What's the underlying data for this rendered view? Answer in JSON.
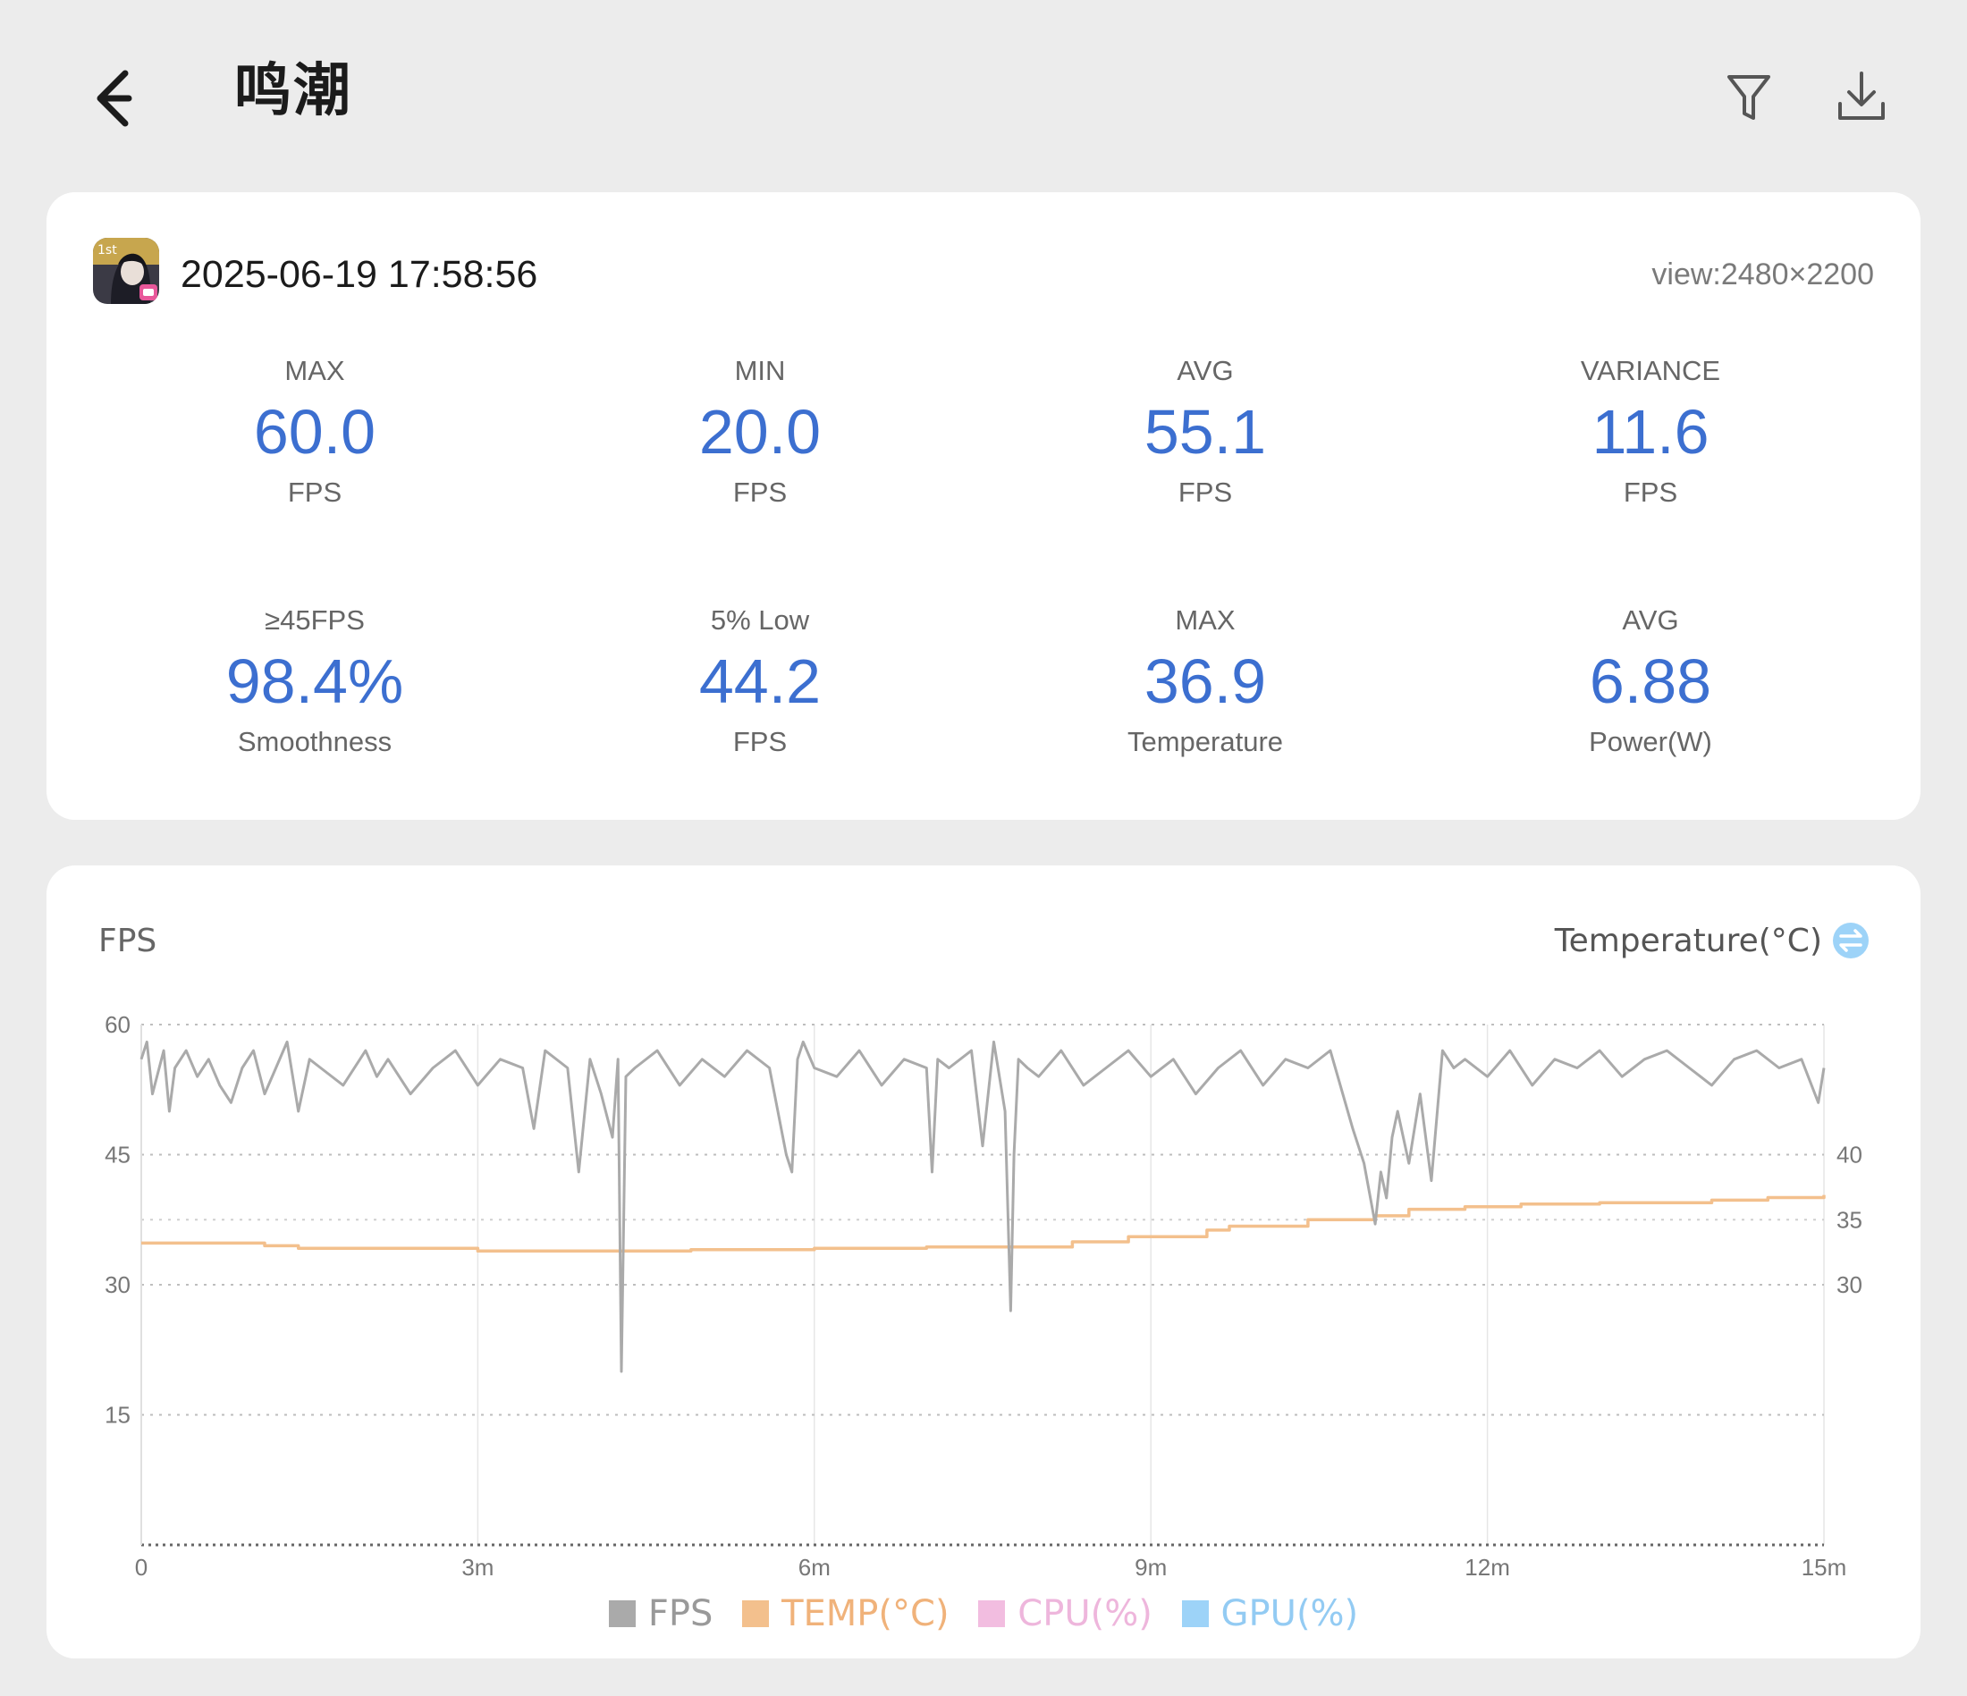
{
  "header": {
    "title": "鸣潮",
    "back_icon": "arrow-left-icon",
    "filter_icon": "filter-icon",
    "download_icon": "download-icon"
  },
  "session": {
    "datetime": "2025-06-19 17:58:56",
    "view": "view:2480×2200",
    "app_icon": "game-app-icon"
  },
  "stats": [
    {
      "label": "MAX",
      "value": "60.0",
      "unit": "FPS"
    },
    {
      "label": "MIN",
      "value": "20.0",
      "unit": "FPS"
    },
    {
      "label": "AVG",
      "value": "55.1",
      "unit": "FPS"
    },
    {
      "label": "VARIANCE",
      "value": "11.6",
      "unit": "FPS"
    },
    {
      "label": "≥45FPS",
      "value": "98.4%",
      "unit": "Smoothness"
    },
    {
      "label": "5% Low",
      "value": "44.2",
      "unit": "FPS"
    },
    {
      "label": "MAX",
      "value": "36.9",
      "unit": "Temperature"
    },
    {
      "label": "AVG",
      "value": "6.88",
      "unit": "Power(W)"
    }
  ],
  "colors": {
    "accent": "#3c6fd0",
    "fps": "#aaaaaa",
    "temp": "#f3c08d",
    "cpu": "#f2bde0",
    "gpu": "#9dd3f8"
  },
  "chart": {
    "y_title": "FPS",
    "y2_title": "Temperature(°C)",
    "swap_icon": "swap-axis-icon"
  },
  "chart_data": {
    "type": "line",
    "xlabel": "",
    "x_ticks": [
      "0",
      "3m",
      "6m",
      "9m",
      "12m",
      "15m"
    ],
    "xlim": [
      0,
      15
    ],
    "y_ticks": [
      "15",
      "30",
      "45",
      "60"
    ],
    "ylim": [
      0,
      60
    ],
    "y2_ticks": [
      "30",
      "35",
      "40"
    ],
    "y2lim": [
      20,
      40
    ],
    "legend": [
      "FPS",
      "TEMP(°C)",
      "CPU(%)",
      "GPU(%)"
    ],
    "legend_position": "bottom",
    "series": [
      {
        "name": "FPS",
        "x": [
          0,
          0.05,
          0.1,
          0.2,
          0.25,
          0.3,
          0.4,
          0.5,
          0.6,
          0.7,
          0.8,
          0.9,
          1.0,
          1.1,
          1.2,
          1.3,
          1.4,
          1.5,
          1.6,
          1.8,
          2.0,
          2.1,
          2.2,
          2.4,
          2.6,
          2.8,
          3.0,
          3.2,
          3.4,
          3.5,
          3.6,
          3.8,
          3.9,
          4.0,
          4.1,
          4.2,
          4.25,
          4.28,
          4.32,
          4.4,
          4.6,
          4.8,
          5.0,
          5.2,
          5.4,
          5.6,
          5.75,
          5.8,
          5.85,
          5.9,
          6.0,
          6.2,
          6.4,
          6.6,
          6.8,
          7.0,
          7.05,
          7.1,
          7.2,
          7.4,
          7.5,
          7.6,
          7.7,
          7.75,
          7.78,
          7.82,
          7.9,
          8.0,
          8.2,
          8.4,
          8.6,
          8.8,
          9.0,
          9.2,
          9.4,
          9.6,
          9.8,
          10.0,
          10.2,
          10.4,
          10.6,
          10.8,
          10.9,
          11.0,
          11.05,
          11.1,
          11.15,
          11.2,
          11.3,
          11.4,
          11.5,
          11.6,
          11.7,
          11.8,
          12.0,
          12.2,
          12.4,
          12.6,
          12.8,
          13.0,
          13.2,
          13.4,
          13.6,
          13.8,
          14.0,
          14.2,
          14.4,
          14.6,
          14.8,
          14.95,
          15.0
        ],
        "y": [
          56,
          58,
          52,
          57,
          50,
          55,
          57,
          54,
          56,
          53,
          51,
          55,
          57,
          52,
          55,
          58,
          50,
          56,
          55,
          53,
          57,
          54,
          56,
          52,
          55,
          57,
          53,
          56,
          55,
          48,
          57,
          55,
          43,
          56,
          52,
          47,
          56,
          20,
          54,
          55,
          57,
          53,
          56,
          54,
          57,
          55,
          45,
          43,
          56,
          58,
          55,
          54,
          57,
          53,
          56,
          55,
          43,
          56,
          55,
          57,
          46,
          58,
          50,
          27,
          45,
          56,
          55,
          54,
          57,
          53,
          55,
          57,
          54,
          56,
          52,
          55,
          57,
          53,
          56,
          55,
          57,
          48,
          44,
          37,
          43,
          40,
          47,
          50,
          44,
          52,
          42,
          57,
          55,
          56,
          54,
          57,
          53,
          56,
          55,
          57,
          54,
          56,
          57,
          55,
          53,
          56,
          57,
          55,
          56,
          51,
          55
        ]
      },
      {
        "name": "TEMP(°C)",
        "x": [
          0,
          1.1,
          1.4,
          3.0,
          4.0,
          4.9,
          6.0,
          7.0,
          8.1,
          8.3,
          8.8,
          9.5,
          9.7,
          10.4,
          11.0,
          11.3,
          11.8,
          12.3,
          13.0,
          13.5,
          14.0,
          14.5,
          15.0
        ],
        "y": [
          33.2,
          33.0,
          32.8,
          32.6,
          32.6,
          32.7,
          32.8,
          32.9,
          32.9,
          33.3,
          33.7,
          34.2,
          34.5,
          35.0,
          35.3,
          35.8,
          36.0,
          36.2,
          36.3,
          36.3,
          36.5,
          36.7,
          36.9
        ]
      },
      {
        "name": "CPU(%)",
        "hidden": true
      },
      {
        "name": "GPU(%)",
        "hidden": true
      }
    ]
  }
}
